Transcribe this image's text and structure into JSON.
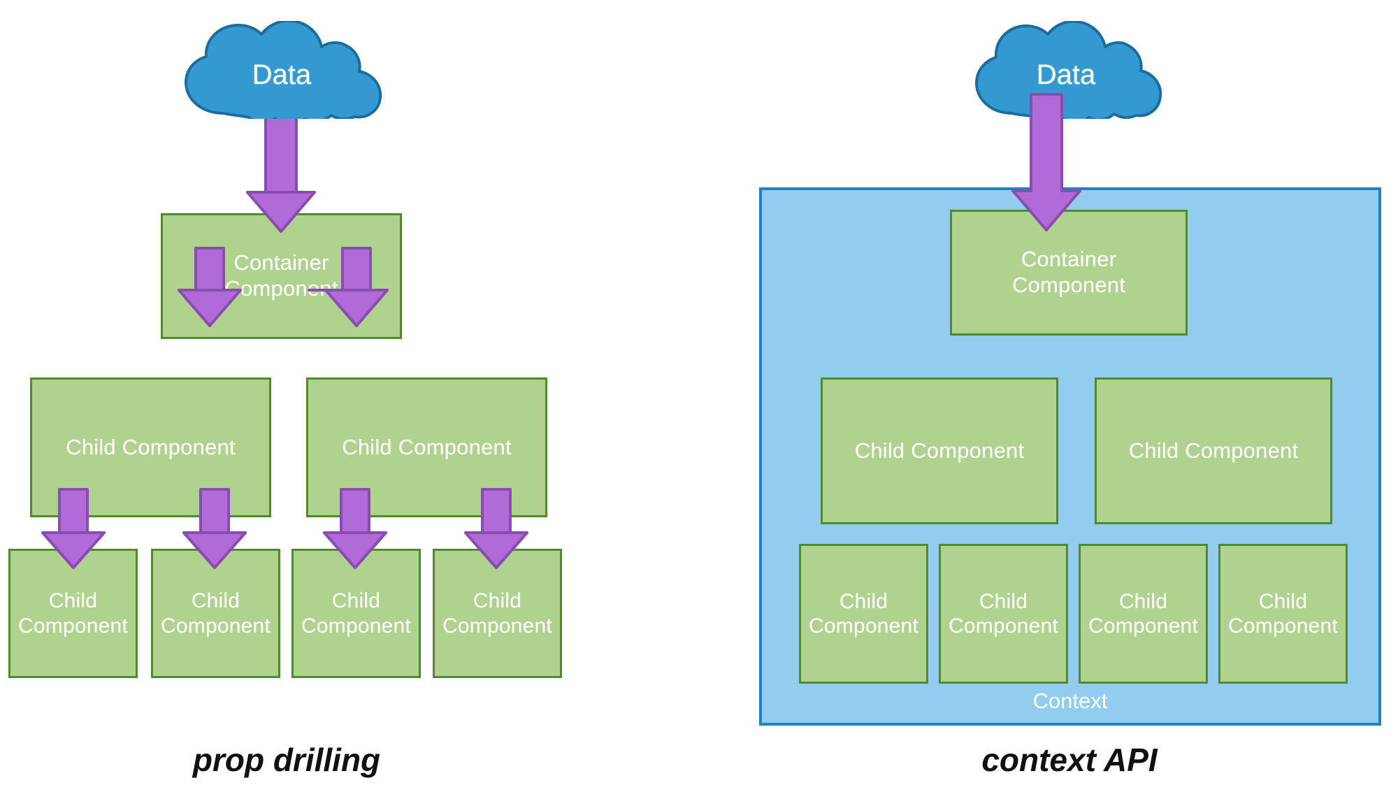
{
  "diagram": {
    "title_absent": true,
    "colors": {
      "box_fill": "#AFD28E",
      "box_border": "#508A2E",
      "cloud_fill": "#3499D0",
      "cloud_border": "#1A6E9E",
      "arrow_fill": "#B06BD9",
      "arrow_border": "#8B4CB0",
      "context_fill": "#92CDEF",
      "context_border": "#1F82C2",
      "label_text": "#FFFFFF",
      "caption_text": "#111111",
      "background": "#FFFFFF"
    }
  },
  "left_panel": {
    "caption": "prop drilling",
    "cloud": {
      "label": "Data",
      "icon": "cloud-icon"
    },
    "container": {
      "label": "Container\nComponent"
    },
    "middle_row": [
      {
        "label": "Child Component"
      },
      {
        "label": "Child Component"
      }
    ],
    "bottom_row": [
      {
        "label": "Child\nComponent"
      },
      {
        "label": "Child\nComponent"
      },
      {
        "label": "Child\nComponent"
      },
      {
        "label": "Child\nComponent"
      }
    ],
    "arrows": [
      {
        "name": "arrow-data-to-container",
        "icon": "down-arrow-icon"
      },
      {
        "name": "arrow-container-to-child-1",
        "icon": "down-arrow-icon"
      },
      {
        "name": "arrow-container-to-child-2",
        "icon": "down-arrow-icon"
      },
      {
        "name": "arrow-child1-to-leaf-1",
        "icon": "down-arrow-icon"
      },
      {
        "name": "arrow-child1-to-leaf-2",
        "icon": "down-arrow-icon"
      },
      {
        "name": "arrow-child2-to-leaf-3",
        "icon": "down-arrow-icon"
      },
      {
        "name": "arrow-child2-to-leaf-4",
        "icon": "down-arrow-icon"
      }
    ]
  },
  "right_panel": {
    "caption": "context API",
    "cloud": {
      "label": "Data",
      "icon": "cloud-icon"
    },
    "context": {
      "label": "Context"
    },
    "container": {
      "label": "Container\nComponent"
    },
    "middle_row": [
      {
        "label": "Child Component"
      },
      {
        "label": "Child Component"
      }
    ],
    "bottom_row": [
      {
        "label": "Child\nComponent"
      },
      {
        "label": "Child\nComponent"
      },
      {
        "label": "Child\nComponent"
      },
      {
        "label": "Child\nComponent"
      }
    ],
    "arrows": [
      {
        "name": "arrow-data-to-container",
        "icon": "down-arrow-icon"
      }
    ]
  }
}
